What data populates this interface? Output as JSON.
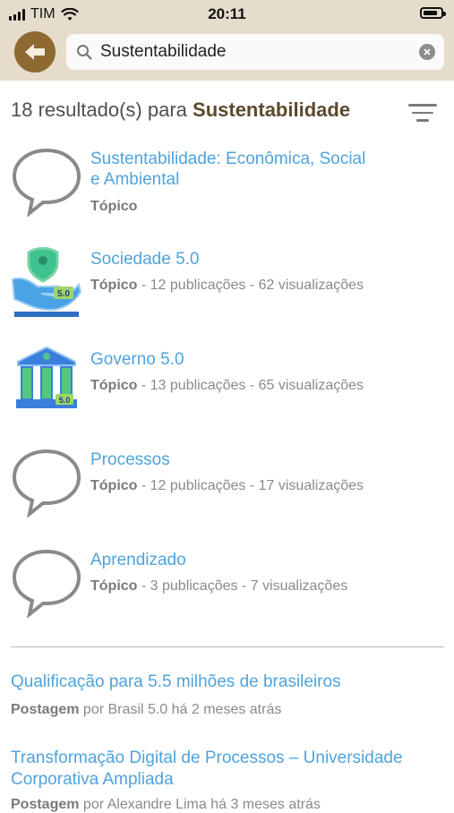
{
  "status_bar": {
    "carrier": "TIM",
    "time": "20:11",
    "battery_level": 0.85
  },
  "header": {
    "search_value": "Sustentabilidade",
    "accent_color": "#8c6a31"
  },
  "results": {
    "count_prefix": "18 resultado(s) para",
    "query": "Sustentabilidade"
  },
  "topics": [
    {
      "title_line1": "Sustentabilidade: Econômica, Social",
      "title_line2": "e Ambiental",
      "kind": "Tópico",
      "stats": "",
      "icon": "speech-bubble-icon"
    },
    {
      "title_line1": "Sociedade 5.0",
      "kind": "Tópico",
      "stats": " - 12 publicações - 62 visualizações",
      "icon": "hand-shield-icon"
    },
    {
      "title_line1": "Governo 5.0",
      "kind": "Tópico",
      "stats": " - 13 publicações - 65 visualizações",
      "icon": "government-building-icon"
    },
    {
      "title_line1": "Processos",
      "kind": "Tópico",
      "stats": " - 12 publicações - 17 visualizações",
      "icon": "speech-bubble-icon"
    },
    {
      "title_line1": "Aprendizado",
      "kind": "Tópico",
      "stats": " - 3 publicações - 7 visualizações",
      "icon": "speech-bubble-icon"
    }
  ],
  "posts": [
    {
      "title": "Qualificação para 5.5 milhões de brasileiros",
      "kind": "Postagem",
      "byline": " por Brasil 5.0 há 2 meses atrás"
    },
    {
      "title": "Transformação Digital de Processos – Universidade Corporativa Ampliada",
      "kind": "Postagem",
      "byline": " por Alexandre Lima há 3 meses atrás"
    }
  ]
}
